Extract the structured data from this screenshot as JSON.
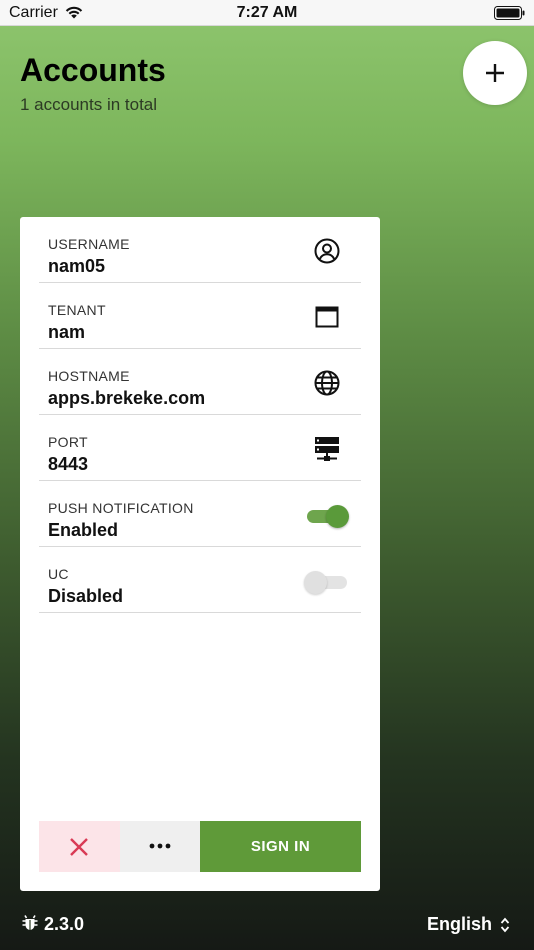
{
  "status_bar": {
    "carrier": "Carrier",
    "time": "7:27 AM",
    "wifi_icon": "wifi-icon",
    "battery_icon": "battery-icon"
  },
  "header": {
    "title": "Accounts",
    "subtitle": "1 accounts in total",
    "add_icon": "plus-icon"
  },
  "account": {
    "fields": [
      {
        "label": "USERNAME",
        "value": "nam05",
        "icon": "user-circle-icon"
      },
      {
        "label": "TENANT",
        "value": "nam",
        "icon": "window-icon"
      },
      {
        "label": "HOSTNAME",
        "value": "apps.brekeke.com",
        "icon": "globe-icon"
      },
      {
        "label": "PORT",
        "value": "8443",
        "icon": "server-icon"
      },
      {
        "label": "PUSH NOTIFICATION",
        "value": "Enabled",
        "toggle_on": true
      },
      {
        "label": "UC",
        "value": "Disabled",
        "toggle_on": false
      }
    ],
    "actions": {
      "delete_icon": "close-icon",
      "more_icon": "more-horizontal-icon",
      "sign_in_label": "SIGN IN"
    }
  },
  "footer": {
    "version": "2.3.0",
    "bug_icon": "bug-icon",
    "language": "English",
    "language_icon": "chevron-up-down-icon"
  },
  "colors": {
    "accent": "#5f9a39",
    "delete_bg": "#fce4e8",
    "delete_icon": "#d93a55"
  }
}
